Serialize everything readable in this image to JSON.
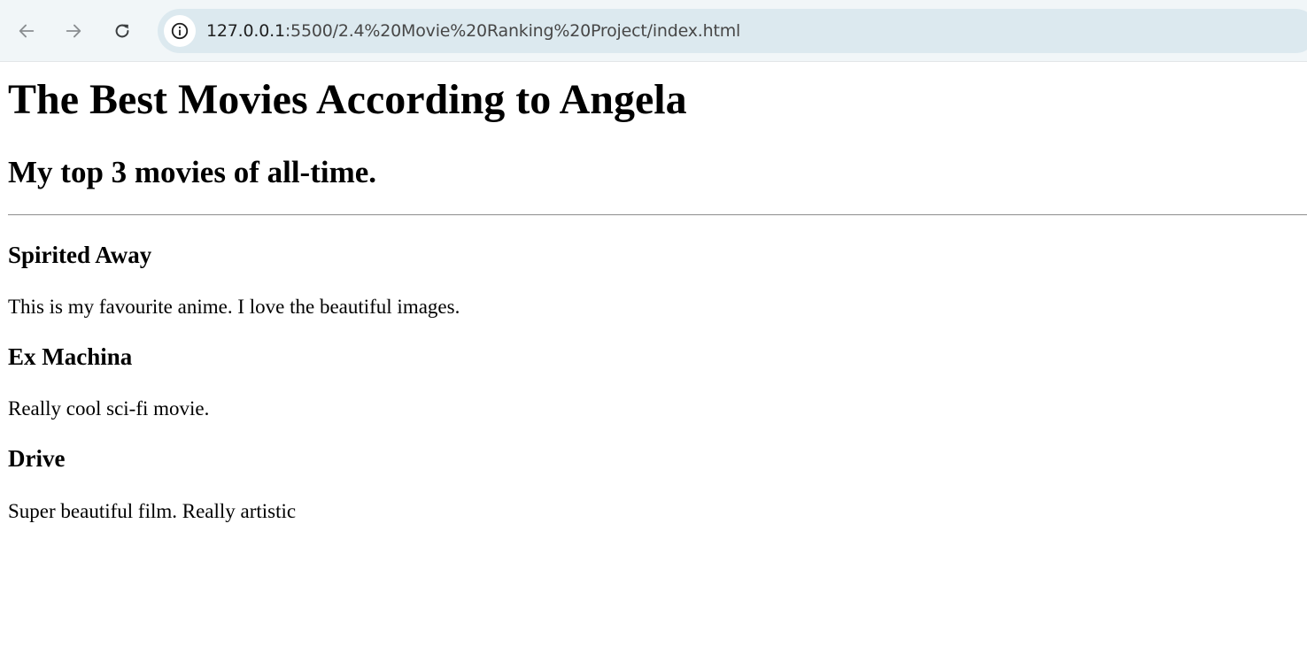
{
  "browser": {
    "url_host": "127.0.0.1",
    "url_rest": ":5500/2.4%20Movie%20Ranking%20Project/index.html",
    "icons": {
      "back": "arrow-left-icon",
      "forward": "arrow-right-icon",
      "reload": "reload-icon",
      "site_info": "info-icon"
    }
  },
  "page": {
    "title": "The Best Movies According to Angela",
    "subtitle": "My top 3 movies of all-time.",
    "movies": [
      {
        "title": "Spirited Away",
        "description": "This is my favourite anime. I love the beautiful images."
      },
      {
        "title": "Ex Machina",
        "description": "Really cool sci-fi movie."
      },
      {
        "title": "Drive",
        "description": "Super beautiful film. Really artistic"
      }
    ]
  }
}
